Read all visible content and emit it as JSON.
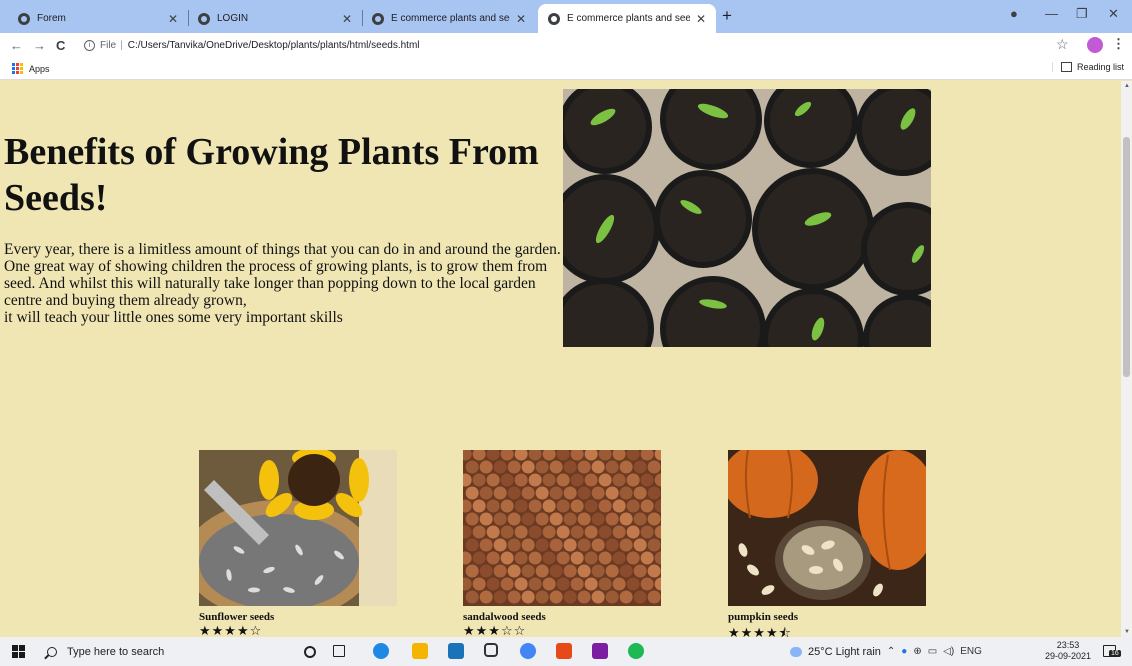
{
  "browser": {
    "tabs": [
      {
        "label": "Forem"
      },
      {
        "label": "LOGIN"
      },
      {
        "label": "E commerce plants and seeds pl"
      },
      {
        "label": "E commerce plants and seeds pl"
      }
    ],
    "url_scheme": "File",
    "url": "C:/Users/Tanvika/OneDrive/Desktop/plants/plants/html/seeds.html",
    "bookmarks": {
      "apps": "Apps",
      "reading_list": "Reading list"
    }
  },
  "page": {
    "title": "Benefits of Growing Plants From Seeds!",
    "intro_lines": [
      "Every year, there is a limitless amount of things that you can do in and around the garden. One great way of showing children the process of growing plants, is to grow them from seed. And whilst this will naturally take longer than popping down to the local garden centre and buying them already grown,",
      "it will teach your little ones some very important skills"
    ],
    "products": [
      {
        "name": "Sunflower seeds",
        "stars": "★★★★☆",
        "rating": 4
      },
      {
        "name": "sandalwood seeds",
        "stars": "★★★☆☆",
        "rating": 3
      },
      {
        "name": "pumpkin seeds",
        "stars": "★★★★⯪",
        "rating": 4.5
      }
    ]
  },
  "taskbar": {
    "search_placeholder": "Type here to search",
    "weather": "25°C  Light rain",
    "language": "ENG",
    "time": "23:53",
    "date": "29-09-2021",
    "notification_count": "16"
  },
  "colors": {
    "page_background": "#f0e6b4",
    "tabbar": "#a8c4f0"
  }
}
